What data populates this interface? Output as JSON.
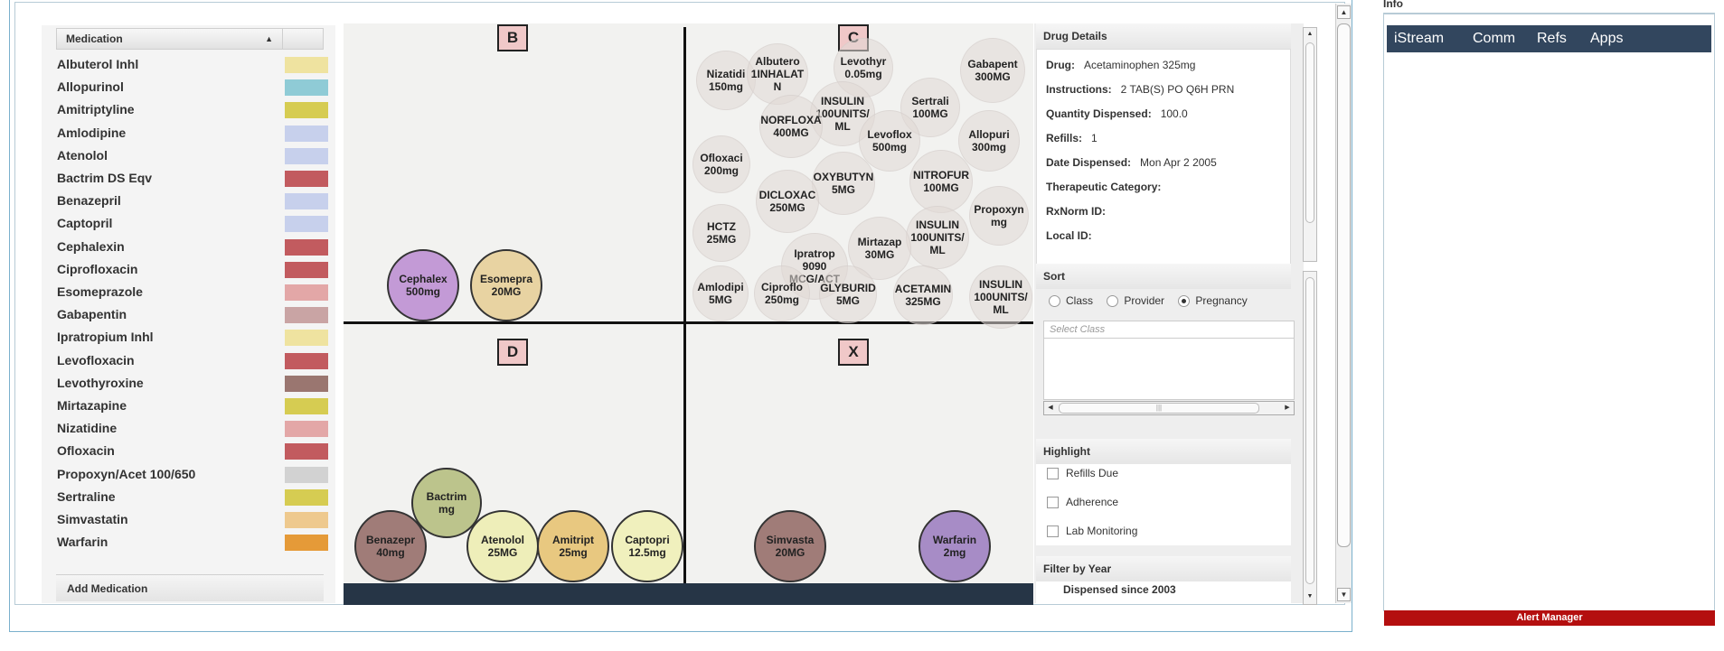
{
  "legend": {
    "header": "Medication",
    "sort_indicator": "▲",
    "add_label": "Add Medication",
    "items": [
      {
        "name": "Albuterol Inhl",
        "color": "#efe3a0"
      },
      {
        "name": "Allopurinol",
        "color": "#8fcbd6"
      },
      {
        "name": "Amitriptyline",
        "color": "#d6cc52"
      },
      {
        "name": "Amlodipine",
        "color": "#c7d0ec"
      },
      {
        "name": "Atenolol",
        "color": "#c7d0ec"
      },
      {
        "name": "Bactrim DS Eqv",
        "color": "#c25b5f"
      },
      {
        "name": "Benazepril",
        "color": "#c7d0ec"
      },
      {
        "name": "Captopril",
        "color": "#c7d0ec"
      },
      {
        "name": "Cephalexin",
        "color": "#c25b5f"
      },
      {
        "name": "Ciprofloxacin",
        "color": "#c25b5f"
      },
      {
        "name": "Esomeprazole",
        "color": "#e3a7a7"
      },
      {
        "name": "Gabapentin",
        "color": "#c9a4a4"
      },
      {
        "name": "Ipratropium Inhl",
        "color": "#efe3a0"
      },
      {
        "name": "Levofloxacin",
        "color": "#c25b5f"
      },
      {
        "name": "Levothyroxine",
        "color": "#9a7670"
      },
      {
        "name": "Mirtazapine",
        "color": "#d6cc52"
      },
      {
        "name": "Nizatidine",
        "color": "#e3a7a7"
      },
      {
        "name": "Ofloxacin",
        "color": "#c25b5f"
      },
      {
        "name": "Propoxyn/Acet 100/650",
        "color": "#d2d2d2"
      },
      {
        "name": "Sertraline",
        "color": "#d6cc52"
      },
      {
        "name": "Simvastatin",
        "color": "#eec98e"
      },
      {
        "name": "Warfarin",
        "color": "#e59a38"
      }
    ]
  },
  "quadrants": {
    "b": "B",
    "c": "C",
    "d": "D",
    "x": "X"
  },
  "background_pills": [
    {
      "l1": "Nizatidi",
      "l2": "150mg",
      "l3": ""
    },
    {
      "l1": "Albutero",
      "l2": "1INHALAT",
      "l3": "N"
    },
    {
      "l1": "Levothyr",
      "l2": "0.05mg",
      "l3": ""
    },
    {
      "l1": "Gabapent",
      "l2": "300MG",
      "l3": ""
    },
    {
      "l1": "INSULIN",
      "l2": "100UNITS/",
      "l3": "ML"
    },
    {
      "l1": "Sertrali",
      "l2": "100MG",
      "l3": ""
    },
    {
      "l1": "NORFLOXA",
      "l2": "400MG",
      "l3": ""
    },
    {
      "l1": "Levoflox",
      "l2": "500mg",
      "l3": ""
    },
    {
      "l1": "Allopuri",
      "l2": "300mg",
      "l3": ""
    },
    {
      "l1": "Ofloxaci",
      "l2": "200mg",
      "l3": ""
    },
    {
      "l1": "OXYBUTYN",
      "l2": "5MG",
      "l3": ""
    },
    {
      "l1": "NITROFUR",
      "l2": "100MG",
      "l3": ""
    },
    {
      "l1": "DICLOXAC",
      "l2": "250MG",
      "l3": ""
    },
    {
      "l1": "Propoxyn",
      "l2": "mg",
      "l3": ""
    },
    {
      "l1": "HCTZ",
      "l2": "25MG",
      "l3": ""
    },
    {
      "l1": "INSULIN",
      "l2": "100UNITS/",
      "l3": "ML"
    },
    {
      "l1": "Mirtazap",
      "l2": "30MG",
      "l3": ""
    },
    {
      "l1": "Ipratrop",
      "l2": "9090",
      "l3": "MCG/ACT"
    },
    {
      "l1": "Amlodipi",
      "l2": "5MG",
      "l3": ""
    },
    {
      "l1": "Ciproflo",
      "l2": "250mg",
      "l3": ""
    },
    {
      "l1": "GLYBURID",
      "l2": "5MG",
      "l3": ""
    },
    {
      "l1": "ACETAMIN",
      "l2": "325MG",
      "l3": ""
    },
    {
      "l1": "INSULIN",
      "l2": "100UNITS/",
      "l3": "ML"
    }
  ],
  "pills": [
    {
      "l1": "Cephalex",
      "l2": "500mg",
      "color": "#c39ad6"
    },
    {
      "l1": "Esomepra",
      "l2": "20MG",
      "color": "#e8d3a2"
    },
    {
      "l1": "Bactrim",
      "l2": "mg",
      "color": "#bcc48c"
    },
    {
      "l1": "Benazepr",
      "l2": "40mg",
      "color": "#a07c78"
    },
    {
      "l1": "Atenolol",
      "l2": "25MG",
      "color": "#eeeeb9"
    },
    {
      "l1": "Amitript",
      "l2": "25mg",
      "color": "#e8c880"
    },
    {
      "l1": "Captopri",
      "l2": "12.5mg",
      "color": "#f0f0bd"
    },
    {
      "l1": "Simvasta",
      "l2": "20MG",
      "color": "#a07c78"
    },
    {
      "l1": "Warfarin",
      "l2": "2mg",
      "color": "#a78cc6"
    }
  ],
  "details": {
    "title": "Drug Details",
    "drug_label": "Drug:",
    "drug_value": "Acetaminophen 325mg",
    "instructions_label": "Instructions:",
    "instructions_value": "2 TAB(S) PO Q6H PRN",
    "quantity_label": "Quantity Dispensed:",
    "quantity_value": "100.0",
    "refills_label": "Refills:",
    "refills_value": "1",
    "date_label": "Date Dispensed:",
    "date_value": "Mon Apr 2  2005",
    "category_label": "Therapeutic Category:",
    "rxnorm_label": "RxNorm ID:",
    "local_label": "Local ID:"
  },
  "sort": {
    "title": "Sort",
    "option1": "Class",
    "option2": "Provider",
    "option3": "Pregnancy",
    "select_placeholder": "Select Class"
  },
  "highlight": {
    "title": "Highlight",
    "opt1": "Refills Due",
    "opt2": "Adherence",
    "opt3": "Lab Monitoring"
  },
  "filter": {
    "title": "Filter by Year",
    "subtitle": "Dispensed since 2003"
  },
  "info": {
    "title": "Info",
    "tabs": [
      "iStream",
      "Comm",
      "Refs",
      "Apps"
    ],
    "alert": "Alert Manager"
  }
}
